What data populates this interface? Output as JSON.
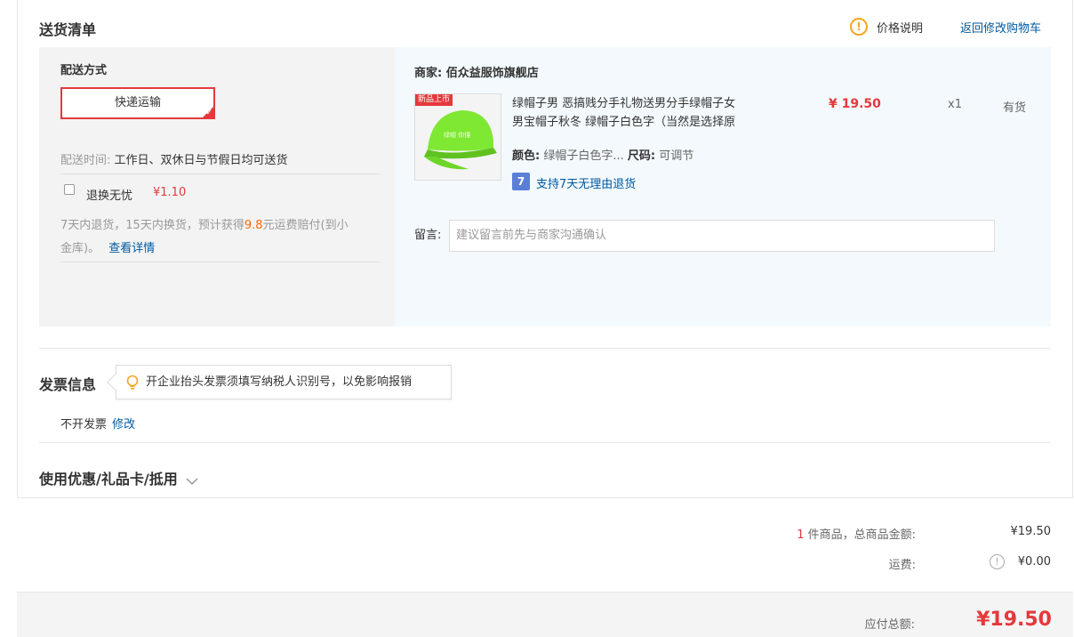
{
  "section_title": "送货清单",
  "price_info_link": "价格说明",
  "back_cart_link": "返回修改购物车",
  "shipping": {
    "heading": "配送方式",
    "method": "快递运输",
    "time_label": "配送时间:",
    "time_value": "工作日、双休日与节假日均可送货",
    "insurance_label": "退换无忧",
    "insurance_price": "¥1.10",
    "insurance_desc_1": "7天内退货，15天内换货，预计获得",
    "insurance_highlight": "9.8",
    "insurance_desc_2": "元运费赔付(到小",
    "insurance_desc_3": "金库)。",
    "insurance_detail_link": "查看详情"
  },
  "merchant": {
    "label": "商家:",
    "name": "佰众益服饰旗舰店"
  },
  "product": {
    "badge": "新品上市",
    "title_line1": "绿帽子男 恶搞贱分手礼物送男分手绿帽子女",
    "title_line2": "男宝帽子秋冬 绿帽子白色字（当然是选择原",
    "price": "¥ 19.50",
    "quantity": "x1",
    "stock": "有货",
    "color_label": "颜色:",
    "color_value": "绿帽子白色字...",
    "size_label": "尺码:",
    "size_value": "可调节",
    "return_badge": "7",
    "return_policy": "支持7天无理由退货"
  },
  "message": {
    "label": "留言:",
    "placeholder": "建议留言前先与商家沟通确认"
  },
  "invoice": {
    "title": "发票信息",
    "tip": "开企业抬头发票须填写纳税人识别号，以免影响报销",
    "value": "不开发票",
    "edit_link": "修改"
  },
  "coupon": {
    "title": "使用优惠/礼品卡/抵用"
  },
  "summary": {
    "count": "1",
    "count_label": "件商品，总商品金额:",
    "goods_total": "¥19.50",
    "freight_label": "运费:",
    "freight_value": "¥0.00",
    "payable_label": "应付总额:",
    "payable_value": "¥19.50"
  },
  "colors": {
    "accent_red": "#e4393c",
    "link_blue": "#005aa0",
    "warning_orange": "#f5a623",
    "hat_green": "#7ee832"
  }
}
